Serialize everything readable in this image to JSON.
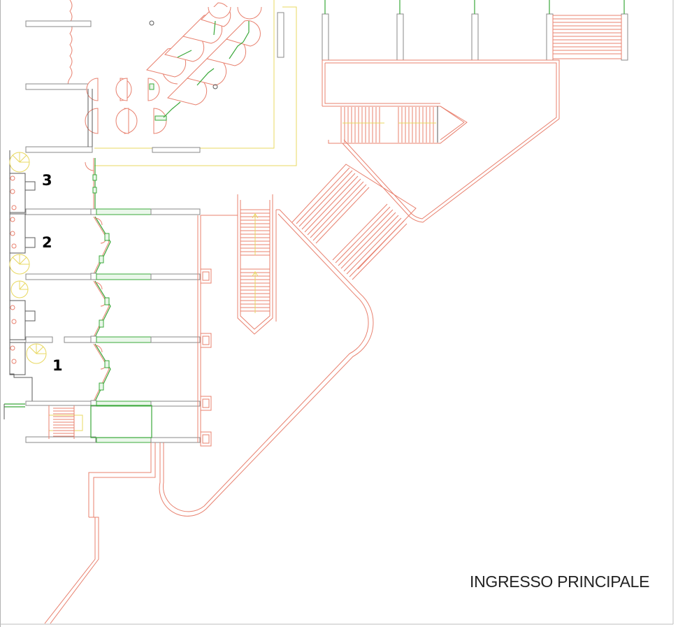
{
  "plan": {
    "zone_labels": [
      {
        "id": "3",
        "text": "3"
      },
      {
        "id": "2",
        "text": "2"
      },
      {
        "id": "1",
        "text": "1"
      }
    ],
    "entrance_label": "INGRESSO PRINCIPALE",
    "colors": {
      "walls": "#e8806e",
      "openings": "#3aa83a",
      "partitions": "#8a8a8a",
      "fixtures": "#e8d860",
      "text": "#222222"
    }
  }
}
